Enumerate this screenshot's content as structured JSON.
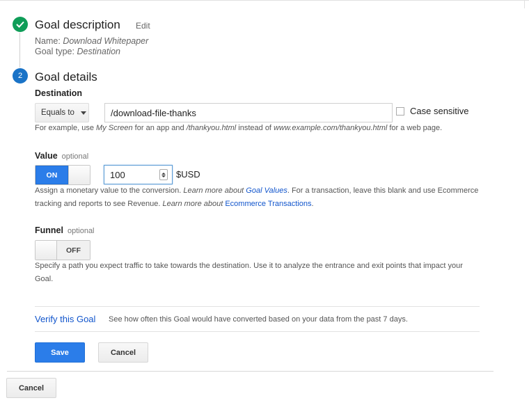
{
  "goal_description": {
    "title": "Goal description",
    "edit_label": "Edit",
    "name_label": "Name:",
    "name_value": "Download Whitepaper",
    "type_label": "Goal type:",
    "type_value": "Destination"
  },
  "goal_details": {
    "step_number": "2",
    "title": "Goal details",
    "destination": {
      "label": "Destination",
      "match_type": "Equals to",
      "value": "/download-file-thanks",
      "case_sensitive_label": "Case sensitive",
      "case_sensitive_checked": false,
      "help": {
        "p1": "For example, use ",
        "e1": "My Screen",
        "p2": " for an app and ",
        "e2": "/thankyou.html",
        "p3": " instead of ",
        "e3": "www.example.com/thankyou.html",
        "p4": " for a web page."
      }
    },
    "value": {
      "label": "Value",
      "optional": "optional",
      "toggle_label": "ON",
      "amount": "100",
      "currency": "$USD",
      "help": {
        "p1": "Assign a monetary value to the conversion. ",
        "e1": "Learn more about ",
        "link1": "Goal Values",
        "p2": ". For a transaction, leave this blank and use Ecommerce tracking and reports to see Revenue. ",
        "e2": "Learn more about ",
        "link2": "Ecommerce Transactions",
        "p3": "."
      }
    },
    "funnel": {
      "label": "Funnel",
      "optional": "optional",
      "toggle_label": "OFF",
      "help": "Specify a path you expect traffic to take towards the destination. Use it to analyze the entrance and exit points that impact your Goal."
    },
    "verify": {
      "link": "Verify this Goal",
      "description": "See how often this Goal would have converted based on your data from the past 7 days."
    },
    "save_label": "Save",
    "cancel_label": "Cancel"
  },
  "footer": {
    "cancel_label": "Cancel"
  },
  "colors": {
    "success_green": "#0f9d58",
    "step_blue": "#1a73c7",
    "primary_button": "#2b7de9",
    "link": "#1155cc"
  }
}
